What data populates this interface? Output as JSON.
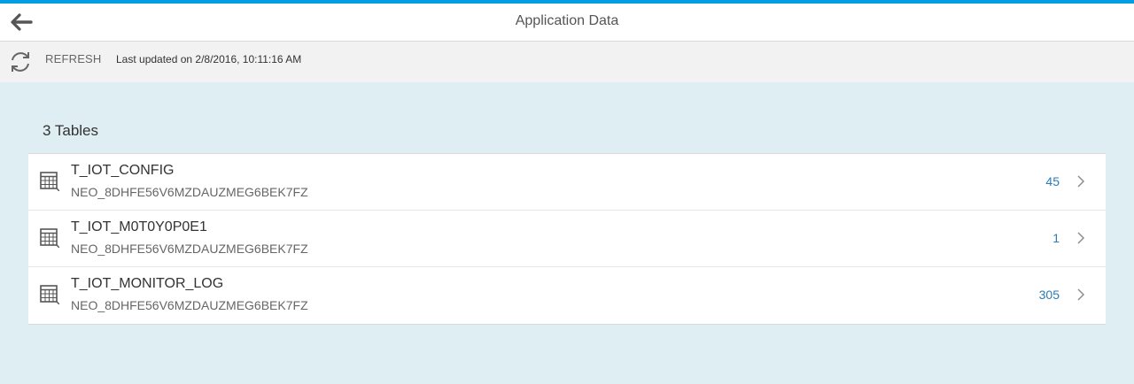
{
  "header": {
    "title": "Application Data",
    "back_icon": "arrow-left-icon"
  },
  "toolbar": {
    "refresh_icon": "refresh-icon",
    "refresh_label": "REFRESH",
    "last_updated": "Last updated on 2/8/2016, 10:11:16 AM"
  },
  "main": {
    "tables_title": "3 Tables",
    "rows": [
      {
        "name": "T_IOT_CONFIG",
        "schema": "NEO_8DHFE56V6MZDAUZMEG6BEK7FZ",
        "count": "45"
      },
      {
        "name": "T_IOT_M0T0Y0P0E1",
        "schema": "NEO_8DHFE56V6MZDAUZMEG6BEK7FZ",
        "count": "1"
      },
      {
        "name": "T_IOT_MONITOR_LOG",
        "schema": "NEO_8DHFE56V6MZDAUZMEG6BEK7FZ",
        "count": "305"
      }
    ]
  },
  "colors": {
    "accent": "#009de0",
    "count_text": "#2b7cb8",
    "content_bg": "#dfeef2",
    "toolbar_bg": "#f2f2f2"
  }
}
